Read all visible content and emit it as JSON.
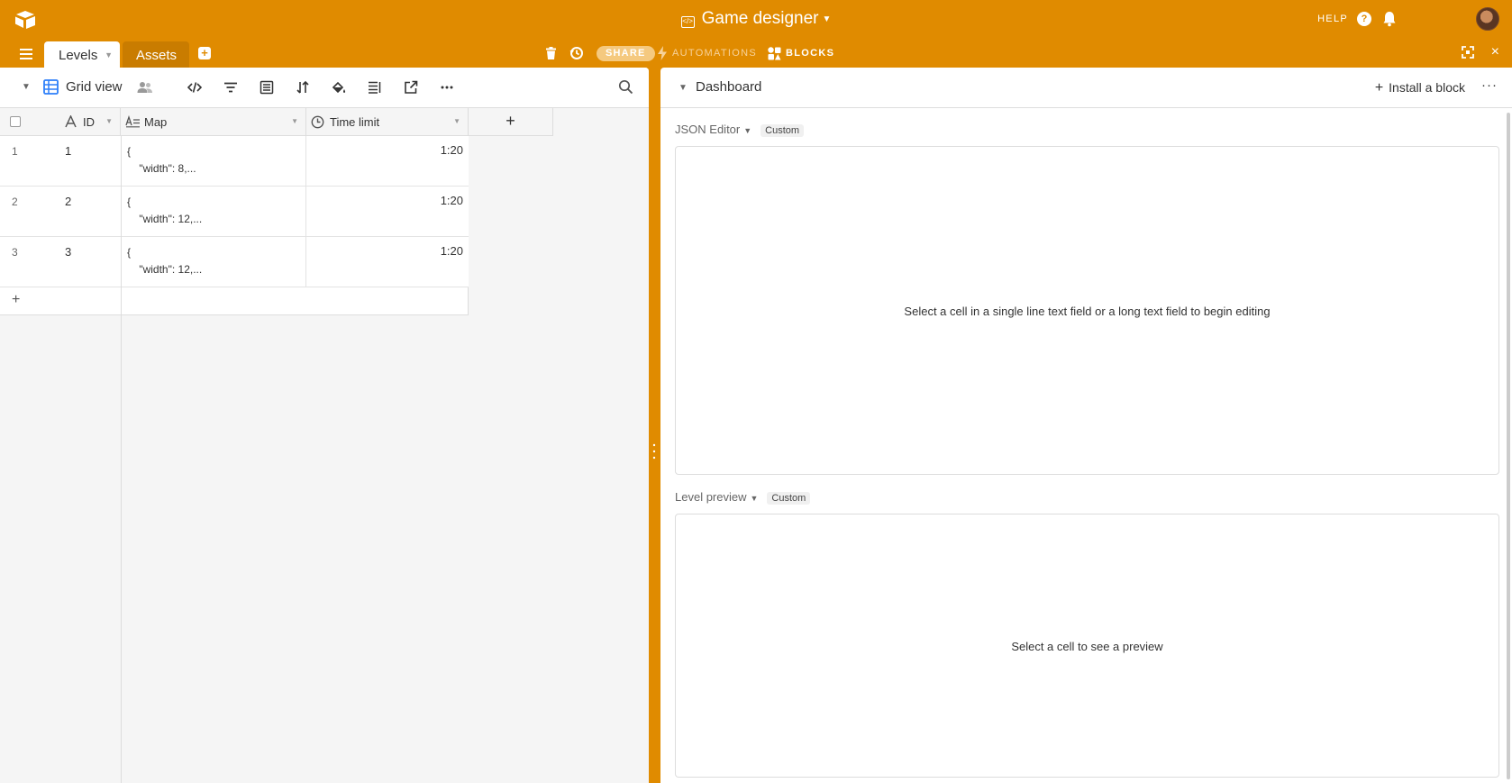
{
  "app": {
    "base_title": "Game designer",
    "help_label": "HELP",
    "accent_color": "#e08b00"
  },
  "tabs": [
    {
      "label": "Levels",
      "active": true
    },
    {
      "label": "Assets",
      "active": false
    }
  ],
  "toolbar": {
    "share_label": "SHARE",
    "automations_label": "AUTOMATIONS",
    "blocks_label": "BLOCKS",
    "close_label": "×"
  },
  "view": {
    "name": "Grid view",
    "icons": [
      "code-icon",
      "filter-icon",
      "group-icon",
      "sort-icon",
      "color-icon",
      "row-height-icon",
      "share-view-icon",
      "more-icon"
    ]
  },
  "grid": {
    "columns": [
      {
        "label": "ID",
        "icon": "text-icon"
      },
      {
        "label": "Map",
        "icon": "long-text-icon"
      },
      {
        "label": "Time limit",
        "icon": "clock-icon"
      }
    ],
    "add_field_label": "+",
    "add_row_label": "+",
    "rows": [
      {
        "num": "1",
        "id": "1",
        "map": "{\n    \"width\": 8,...",
        "time": "1:20"
      },
      {
        "num": "2",
        "id": "2",
        "map": "{\n    \"width\": 12,...",
        "time": "1:20"
      },
      {
        "num": "3",
        "id": "3",
        "map": "{\n    \"width\": 12,...",
        "time": "1:20"
      }
    ]
  },
  "dashboard": {
    "title": "Dashboard",
    "install_label": "Install a block",
    "more_label": "···",
    "blocks": [
      {
        "name": "JSON Editor",
        "tag": "Custom",
        "message": "Select a cell in a single line text field or a long text field to begin editing"
      },
      {
        "name": "Level preview",
        "tag": "Custom",
        "message": "Select a cell to see a preview"
      }
    ]
  }
}
